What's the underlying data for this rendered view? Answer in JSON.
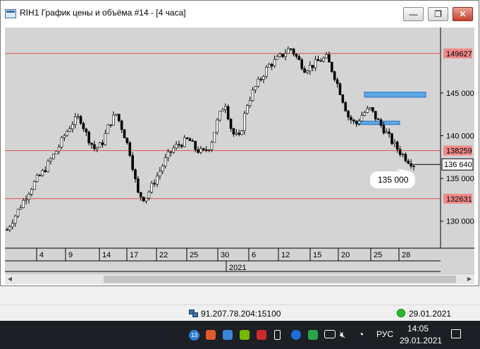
{
  "window": {
    "title": "RIH1 График цены и объёма #14 - [4 часа]",
    "controls": {
      "minimize": "—",
      "restore": "❐",
      "close": "✕"
    }
  },
  "chart_data": {
    "type": "candlestick",
    "title": "",
    "y_axis_labels": [
      "145 000",
      "140 000",
      "135 000",
      "130 000"
    ],
    "y_axis_values": [
      145000,
      140000,
      135000,
      130000
    ],
    "ylim": [
      127500,
      152000
    ],
    "horizontal_levels": [
      {
        "label": "149627",
        "value": 149627,
        "color": "#e05050"
      },
      {
        "label": "138259",
        "value": 138259,
        "color": "#e05050"
      },
      {
        "label": "132631",
        "value": 132631,
        "color": "#e05050"
      }
    ],
    "current_price_label": "136 640",
    "current_price": 136640,
    "annotation": {
      "text": "135 000",
      "value": 135000
    },
    "x_ticks": [
      "4",
      "9",
      "14",
      "17",
      "22",
      "25",
      "30",
      "6",
      "12",
      "15",
      "20",
      "25",
      "28"
    ],
    "x_year_label": "2021",
    "zones": [
      {
        "from": 144500,
        "to": 145100
      },
      {
        "from": 141300,
        "to": 141700
      }
    ],
    "price_path": [
      129000,
      130500,
      132000,
      133500,
      134800,
      135800,
      137200,
      138500,
      140200,
      141500,
      142200,
      140000,
      138500,
      138900,
      141200,
      142600,
      140500,
      137800,
      133200,
      132600,
      134200,
      135800,
      137500,
      138600,
      139100,
      139600,
      138400,
      138000,
      138900,
      141800,
      144000,
      140300,
      139700,
      143600,
      145400,
      146800,
      148200,
      148800,
      149500,
      150300,
      149000,
      147800,
      148200,
      148800,
      149100,
      147200,
      144800,
      142200,
      141300,
      142600,
      143100,
      141800,
      140600,
      139300,
      138200,
      137300,
      136640
    ],
    "grid": false
  },
  "status": {
    "server": "91.207.78.204:15100",
    "date": "29.01.2021"
  },
  "taskbar": {
    "lang": "РУС",
    "time": "14:05",
    "date": "29.01.2021",
    "badge": "13"
  }
}
